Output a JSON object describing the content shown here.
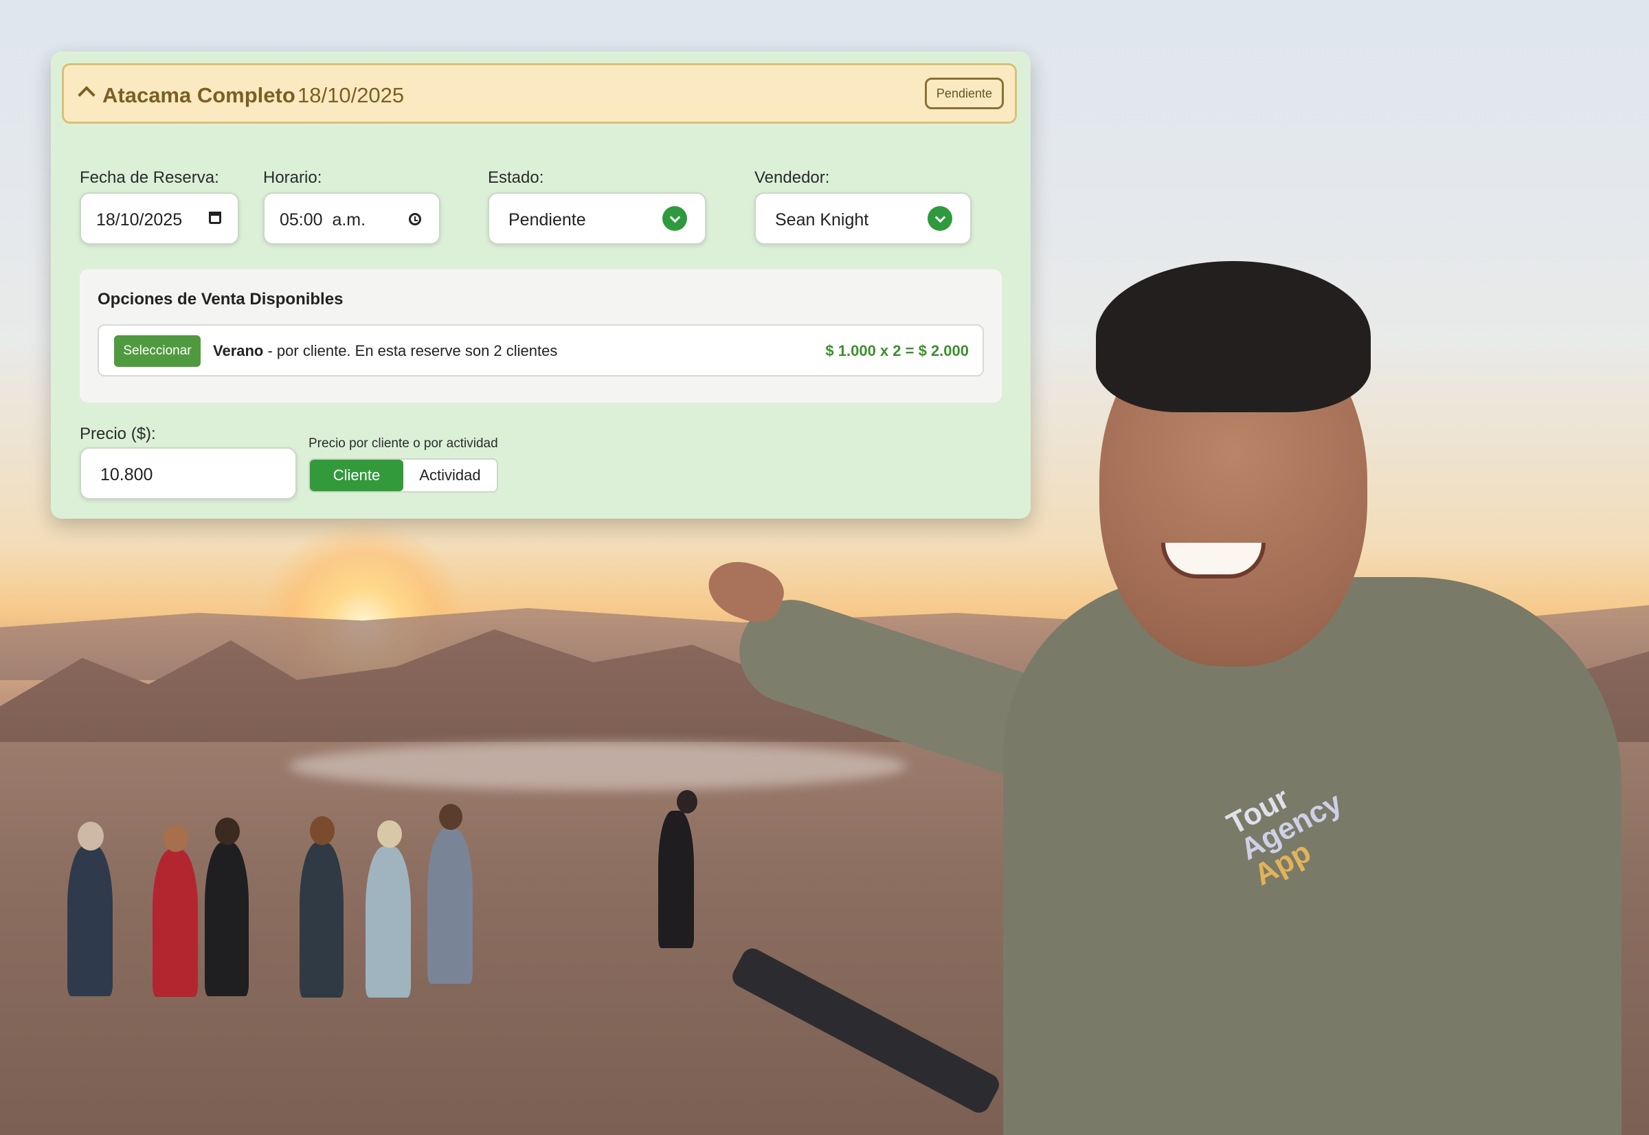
{
  "colors": {
    "panel_bg": "#dcf0d8",
    "header_bg": "#fbeac1",
    "accent_green": "#339a3c",
    "header_text": "#7b5f22",
    "price_green": "#3d8f2e"
  },
  "booking": {
    "tour_name": "Atacama Completo",
    "tour_date": "18/10/2025",
    "status_badge": "Pendiente",
    "collapse_icon": "chevron-up-icon"
  },
  "form": {
    "fecha_label": "Fecha de Reserva:",
    "fecha_value": "18/10/2025",
    "horario_label": "Horario:",
    "horario_value": "05:00  a.m.",
    "estado_label": "Estado:",
    "estado_value": "Pendiente",
    "vendedor_label": "Vendedor:",
    "vendedor_value": "Sean Knight"
  },
  "sale_options": {
    "title": "Opciones de Venta Disponibles",
    "items": [
      {
        "select_label": "Seleccionar",
        "name": "Verano",
        "description": " - por cliente. En esta reserve son 2 clientes",
        "price_calc": "$ 1.000 x 2 = $ 2.000"
      }
    ]
  },
  "pricing": {
    "price_label": "Precio ($):",
    "price_value": "10.800",
    "mode_label": "Precio por cliente o por actividad",
    "mode_options": [
      "Cliente",
      "Actividad"
    ],
    "mode_selected": "Cliente"
  },
  "background": {
    "shirt_logo": [
      "Tour",
      "Agency",
      "App"
    ]
  }
}
